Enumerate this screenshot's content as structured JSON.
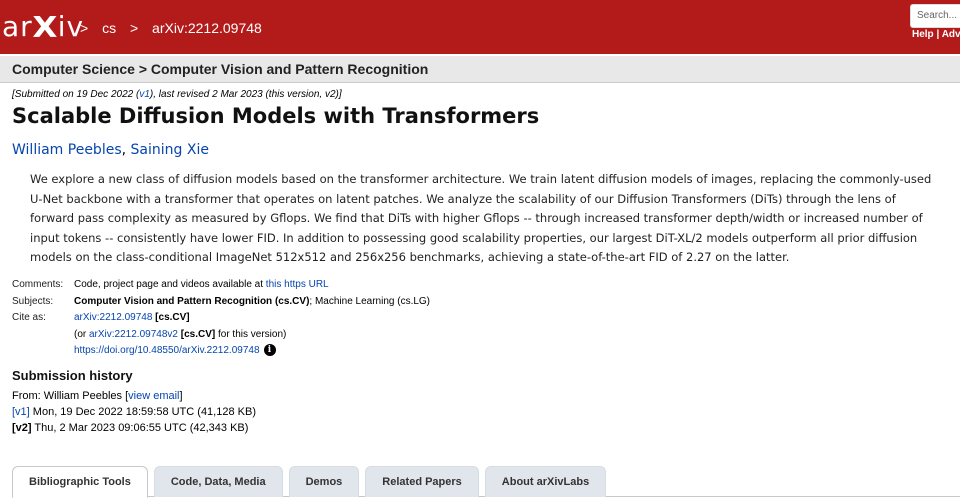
{
  "header": {
    "logo_left": "ar",
    "logo_x": "X",
    "logo_right": "iv",
    "crumbs": [
      ">",
      "cs",
      ">",
      "arXiv:2212.09748"
    ],
    "search_placeholder": "Search...",
    "help": "Help",
    "help_sep": "|",
    "adv": "Adv"
  },
  "subheader": {
    "title": "Computer Science > Computer Vision and Pattern Recognition"
  },
  "submission": {
    "prefix": "[Submitted on 19 Dec 2022 (",
    "v1": "v1",
    "suffix": "), last revised 2 Mar 2023 (this version, v2)]"
  },
  "paper": {
    "title": "Scalable Diffusion Models with Transformers",
    "author1": "William Peebles",
    "author_sep": ", ",
    "author2": "Saining Xie",
    "abstract": "We explore a new class of diffusion models based on the transformer architecture. We train latent diffusion models of images, replacing the commonly-used U-Net backbone with a transformer that operates on latent patches. We analyze the scalability of our Diffusion Transformers (DiTs) through the lens of forward pass complexity as measured by Gflops. We find that DiTs with higher Gflops -- through increased transformer depth/width or increased number of input tokens -- consistently have lower FID. In addition to possessing good scalability properties, our largest DiT-XL/2 models outperform all prior diffusion models on the class-conditional ImageNet 512x512 and 256x256 benchmarks, achieving a state-of-the-art FID of 2.27 on the latter."
  },
  "meta": {
    "comments_label": "Comments:",
    "comments_text": "Code, project page and videos available at ",
    "comments_link": "this https URL",
    "subjects_label": "Subjects:",
    "subjects_primary": "Computer Vision and Pattern Recognition (cs.CV)",
    "subjects_rest": "; Machine Learning (cs.LG)",
    "cite_label": "Cite as:",
    "cite_id": "arXiv:2212.09748",
    "cite_cat": " [cs.CV]",
    "cite2_prefix": "(or ",
    "cite2_id": "arXiv:2212.09748v2",
    "cite2_cat": " [cs.CV]",
    "cite2_suffix": " for this version)",
    "doi": "https://doi.org/10.48550/arXiv.2212.09748",
    "info_glyph": "i"
  },
  "history": {
    "title": "Submission history",
    "from_prefix": "From: William Peebles [",
    "view_email": "view email",
    "from_suffix": "]",
    "v1_label": "[v1]",
    "v1_text": " Mon, 19 Dec 2022 18:59:58 UTC (41,128 KB)",
    "v2_label": "[v2]",
    "v2_text": " Thu, 2 Mar 2023 09:06:55 UTC (42,343 KB)"
  },
  "tabs": [
    "Bibliographic Tools",
    "Code, Data, Media",
    "Demos",
    "Related Papers",
    "About arXivLabs"
  ],
  "colors": {
    "brand": "#b31b1b",
    "link": "#0645ad"
  }
}
